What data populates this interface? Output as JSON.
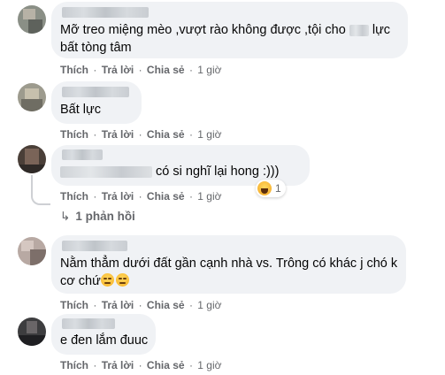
{
  "comments": [
    {
      "lines": [
        "Mỡ treo miệng mèo ,vượt rào không được ,tội cho",
        "lực",
        "bất tòng tâm"
      ],
      "actions": {
        "like": "Thích",
        "reply": "Trả lời",
        "share": "Chia sẻ",
        "time": "1 giờ"
      }
    },
    {
      "text": "Bất lực",
      "actions": {
        "like": "Thích",
        "reply": "Trả lời",
        "share": "Chia sẻ",
        "time": "1 giờ"
      }
    },
    {
      "text": "có si nghĩ lại hong :)))",
      "reaction_count": "1",
      "actions": {
        "like": "Thích",
        "reply": "Trả lời",
        "share": "Chia sẻ",
        "time": "1 giờ"
      },
      "replies_label": "1 phản hồi"
    },
    {
      "line1": "Nằm thẳm dưới đất gần cạnh nhà vs. Trông có khác j chó k",
      "line2": "cơ chứ",
      "actions": {
        "like": "Thích",
        "reply": "Trả lời",
        "share": "Chia sẻ",
        "time": "1 giờ"
      }
    },
    {
      "text": "e đen lắm đuuc",
      "actions": {
        "like": "Thích",
        "reply": "Trả lời",
        "share": "Chia sẻ",
        "time": "1 giờ"
      }
    }
  ],
  "separator": "·",
  "colors": {
    "bubble": "#f0f2f5",
    "meta": "#65676b",
    "text": "#050505"
  }
}
